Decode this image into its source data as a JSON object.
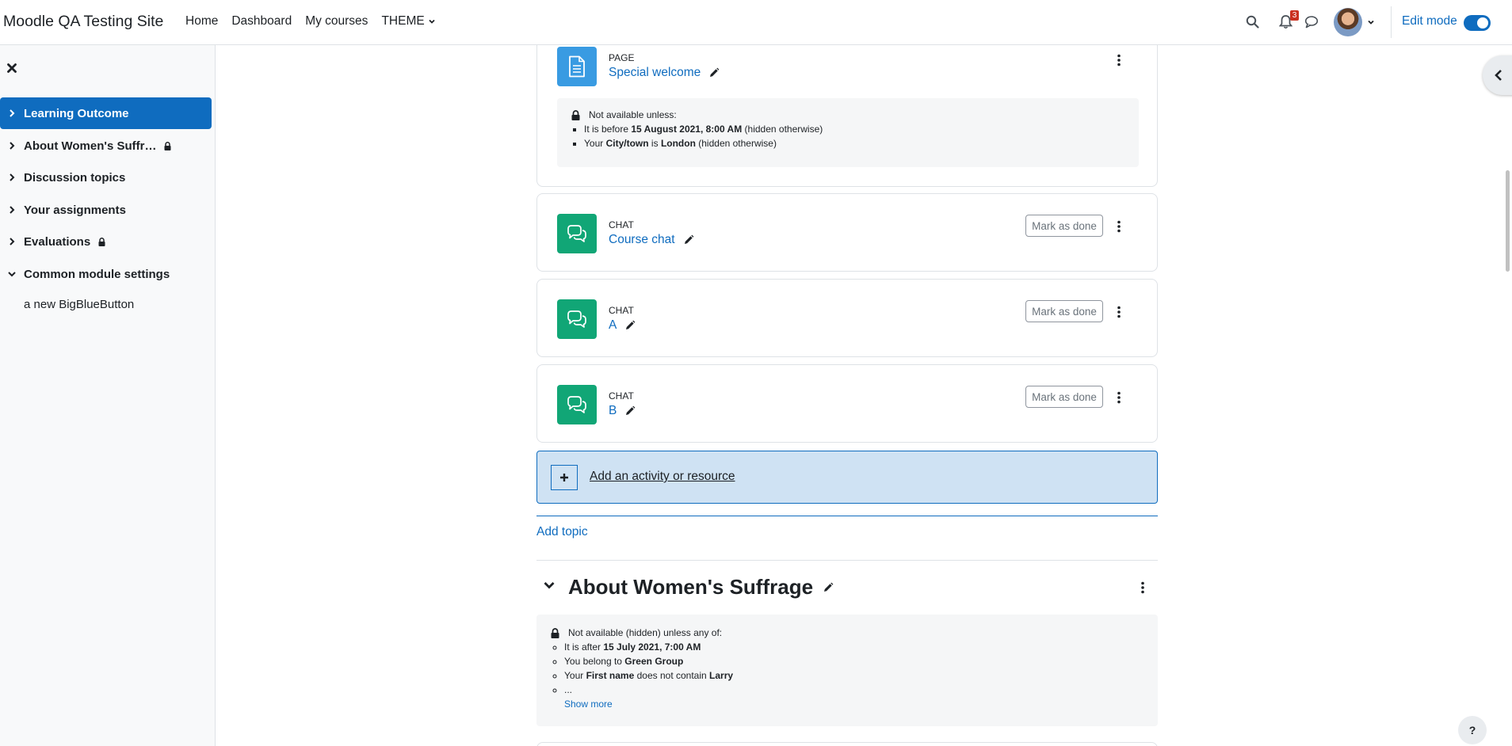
{
  "navbar": {
    "site_name": "Moodle QA Testing Site",
    "links": [
      "Home",
      "Dashboard",
      "My courses"
    ],
    "theme_label": "THEME",
    "notification_count": "3",
    "edit_mode_label": "Edit mode",
    "edit_mode_on": true
  },
  "course_index": {
    "items": [
      {
        "label": "Learning Outcome",
        "active": true,
        "locked": false,
        "expanded": false
      },
      {
        "label": "About Women's Suffr…",
        "active": false,
        "locked": true,
        "expanded": false
      },
      {
        "label": "Discussion topics",
        "active": false,
        "locked": false,
        "expanded": false
      },
      {
        "label": "Your assignments",
        "active": false,
        "locked": false,
        "expanded": false
      },
      {
        "label": "Evaluations",
        "active": false,
        "locked": true,
        "expanded": false
      },
      {
        "label": "Common module settings",
        "active": false,
        "locked": false,
        "expanded": true
      }
    ],
    "sub_items": [
      "a new BigBlueButton"
    ]
  },
  "activities": {
    "page": {
      "type": "PAGE",
      "name": "Special welcome",
      "restriction": {
        "heading": "Not available unless:",
        "conditions": [
          {
            "pre": "It is before ",
            "bold": "15 August 2021, 8:00 AM",
            "post": " (hidden otherwise)"
          },
          {
            "pre": "Your ",
            "bold": "City/town",
            "mid": " is ",
            "bold2": "London",
            "post": " (hidden otherwise)"
          }
        ]
      }
    },
    "chats": [
      {
        "type": "CHAT",
        "name": "Course chat",
        "button": "Mark as done"
      },
      {
        "type": "CHAT",
        "name": "A",
        "button": "Mark as done"
      },
      {
        "type": "CHAT",
        "name": "B",
        "button": "Mark as done"
      }
    ]
  },
  "add_activity_label": "Add an activity or resource",
  "add_topic_label": "Add topic",
  "section": {
    "title": "About Women's Suffrage",
    "restriction": {
      "heading": "Not available (hidden) unless any of:",
      "c1_pre": "It is after ",
      "c1_bold": "15 July 2021, 7:00 AM",
      "c2_pre": "You belong to ",
      "c2_bold": "Green Group",
      "c3_pre": "Your ",
      "c3_bold": "First name",
      "c3_mid": " does not contain ",
      "c3_bold2": "Larry",
      "c4": "...",
      "show_more": "Show more"
    }
  },
  "help_label": "?",
  "colors": {
    "primary": "#0f6cbf",
    "page_icon": "#399be2",
    "chat_icon": "#11a676",
    "badge": "#ca3120"
  },
  "icons": [
    "close-icon",
    "chevron-right-icon",
    "chevron-down-icon",
    "lock-icon",
    "search-icon",
    "bell-icon",
    "message-icon",
    "pencil-icon",
    "kebab-icon",
    "page-icon",
    "chat-icon",
    "plus-icon",
    "chevron-left-icon"
  ]
}
